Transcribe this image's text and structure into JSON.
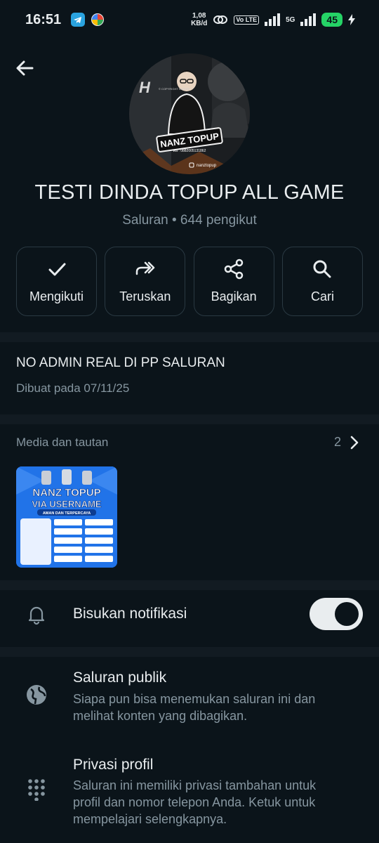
{
  "status_bar": {
    "time": "16:51",
    "speed_value": "1,08",
    "speed_unit": "KB/d",
    "volte": "Vo LTE",
    "network": "5G",
    "battery": "45"
  },
  "header": {
    "back_icon": "arrow-left-icon"
  },
  "avatar": {
    "brand": "NANZ TOPUP",
    "wa": "wa : 0882005131862",
    "ig": "nanztopup",
    "copyright": "© COPYRIGHT KADORI"
  },
  "channel": {
    "title": "TESTI DINDA TOPUP ALL GAME",
    "subtitle": "Saluran • 644 pengikut"
  },
  "actions": [
    {
      "label": "Mengikuti",
      "icon": "check-icon"
    },
    {
      "label": "Teruskan",
      "icon": "forward-icon"
    },
    {
      "label": "Bagikan",
      "icon": "share-icon"
    },
    {
      "label": "Cari",
      "icon": "search-icon"
    }
  ],
  "description": {
    "text": "NO ADMIN REAL DI PP SALURAN",
    "created": "Dibuat pada 07/11/25"
  },
  "media": {
    "title": "Media dan tautan",
    "count": "2",
    "thumb_title_1": "NANZ TOPUP",
    "thumb_title_2": "VIA USERNAME",
    "thumb_tag": "AMAN DAN TERPERCAYA"
  },
  "settings": {
    "mute_label": "Bisukan notifikasi",
    "mute_on": true,
    "public_title": "Saluran publik",
    "public_desc": "Siapa pun bisa menemukan saluran ini dan melihat konten yang dibagikan.",
    "privacy_title": "Privasi profil",
    "privacy_desc": "Saluran ini memiliki privasi tambahan untuk profil dan nomor telepon Anda. Ketuk untuk mempelajari selengkapnya."
  },
  "colors": {
    "background": "#0b141a",
    "accent": "#25d366",
    "muted": "#8696a0"
  }
}
